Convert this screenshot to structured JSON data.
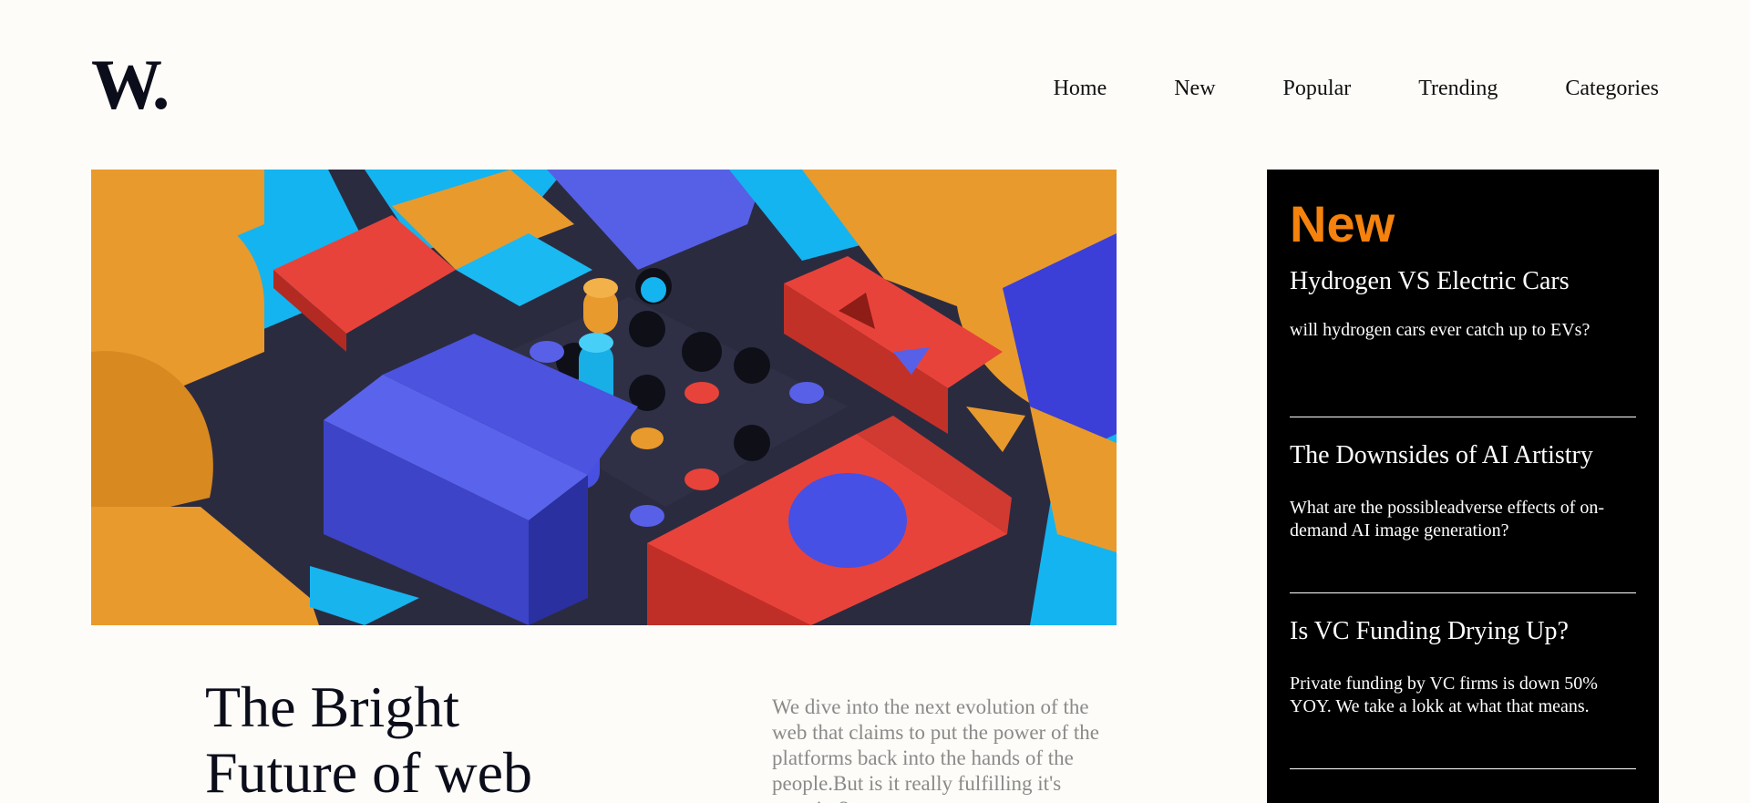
{
  "header": {
    "logo": "W.",
    "nav": [
      "Home",
      "New",
      "Popular",
      "Trending",
      "Categories"
    ]
  },
  "hero": {
    "title": "The Bright Future of web",
    "excerpt": "We dive into the next evolution of the web that claims to put the power of the platforms back into the hands of the people.But is it really fulfilling it's promise?"
  },
  "sidebar": {
    "heading": "New",
    "stories": [
      {
        "title": "Hydrogen VS Electric Cars",
        "summary": "will hydrogen cars ever catch up to EVs?"
      },
      {
        "title": "The Downsides of AI Artistry",
        "summary": "What are the possibleadverse effects of on-demand AI image generation?"
      },
      {
        "title": "Is VC Funding Drying Up?",
        "summary": "Private funding by VC firms is down 50% YOY. We take a lokk at what that means."
      }
    ]
  },
  "colors": {
    "accent": "#f5820d",
    "background": "#fdfcf8",
    "sidebar_bg": "#000000",
    "text_dark": "#0b0d1a",
    "excerpt_gray": "#8a8a8a"
  }
}
